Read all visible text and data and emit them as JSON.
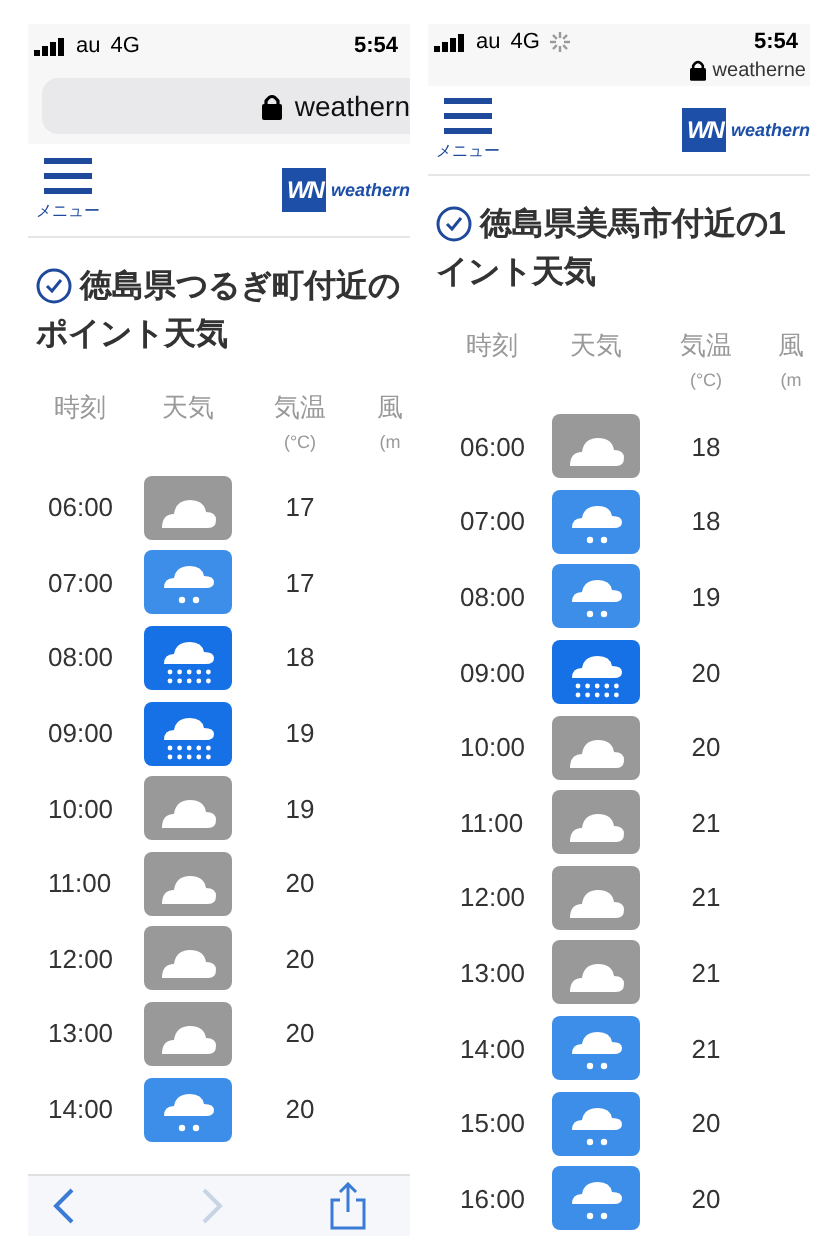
{
  "panels": [
    {
      "status_bar": {
        "carrier": "au",
        "network": "4G",
        "loading": false,
        "time": "5:54"
      },
      "address": {
        "kind": "bar",
        "url": "weathern"
      },
      "nav": {
        "menu_label": "メニュー",
        "logo_mark": "WN",
        "logo_text": "weathern"
      },
      "title_lines": [
        "徳島県つるぎ町付近の",
        "ポイント天気"
      ],
      "columns": [
        {
          "label": "時刻"
        },
        {
          "label": "天気"
        },
        {
          "label": "気温",
          "unit": "(°C)"
        },
        {
          "label": "風",
          "unit": "(m"
        }
      ],
      "rows": [
        {
          "time": "06:00",
          "kind": "cloudy",
          "temp": "17"
        },
        {
          "time": "07:00",
          "kind": "light_rain",
          "temp": "17"
        },
        {
          "time": "08:00",
          "kind": "heavy_rain",
          "temp": "18"
        },
        {
          "time": "09:00",
          "kind": "heavy_rain",
          "temp": "19"
        },
        {
          "time": "10:00",
          "kind": "cloudy",
          "temp": "19"
        },
        {
          "time": "11:00",
          "kind": "cloudy",
          "temp": "20"
        },
        {
          "time": "12:00",
          "kind": "cloudy",
          "temp": "20"
        },
        {
          "time": "13:00",
          "kind": "cloudy",
          "temp": "20"
        },
        {
          "time": "14:00",
          "kind": "light_rain",
          "temp": "20"
        }
      ],
      "toolbar": {
        "back_disabled": false,
        "forward_disabled": true
      }
    },
    {
      "status_bar": {
        "carrier": "au",
        "network": "4G",
        "loading": true,
        "time": "5:54"
      },
      "address": {
        "kind": "compact",
        "url": "weatherne"
      },
      "nav": {
        "menu_label": "メニュー",
        "logo_mark": "WN",
        "logo_text": "weathern"
      },
      "title_lines": [
        "徳島県美馬市付近の1",
        "イント天気"
      ],
      "columns": [
        {
          "label": "時刻"
        },
        {
          "label": "天気"
        },
        {
          "label": "気温",
          "unit": "(°C)"
        },
        {
          "label": "風",
          "unit": "(m"
        }
      ],
      "rows": [
        {
          "time": "06:00",
          "kind": "cloudy",
          "temp": "18"
        },
        {
          "time": "07:00",
          "kind": "light_rain",
          "temp": "18"
        },
        {
          "time": "08:00",
          "kind": "light_rain",
          "temp": "19"
        },
        {
          "time": "09:00",
          "kind": "heavy_rain",
          "temp": "20"
        },
        {
          "time": "10:00",
          "kind": "cloudy",
          "temp": "20"
        },
        {
          "time": "11:00",
          "kind": "cloudy",
          "temp": "21"
        },
        {
          "time": "12:00",
          "kind": "cloudy",
          "temp": "21"
        },
        {
          "time": "13:00",
          "kind": "cloudy",
          "temp": "21"
        },
        {
          "time": "14:00",
          "kind": "light_rain",
          "temp": "21"
        },
        {
          "time": "15:00",
          "kind": "light_rain",
          "temp": "20"
        },
        {
          "time": "16:00",
          "kind": "light_rain",
          "temp": "20"
        }
      ]
    }
  ]
}
